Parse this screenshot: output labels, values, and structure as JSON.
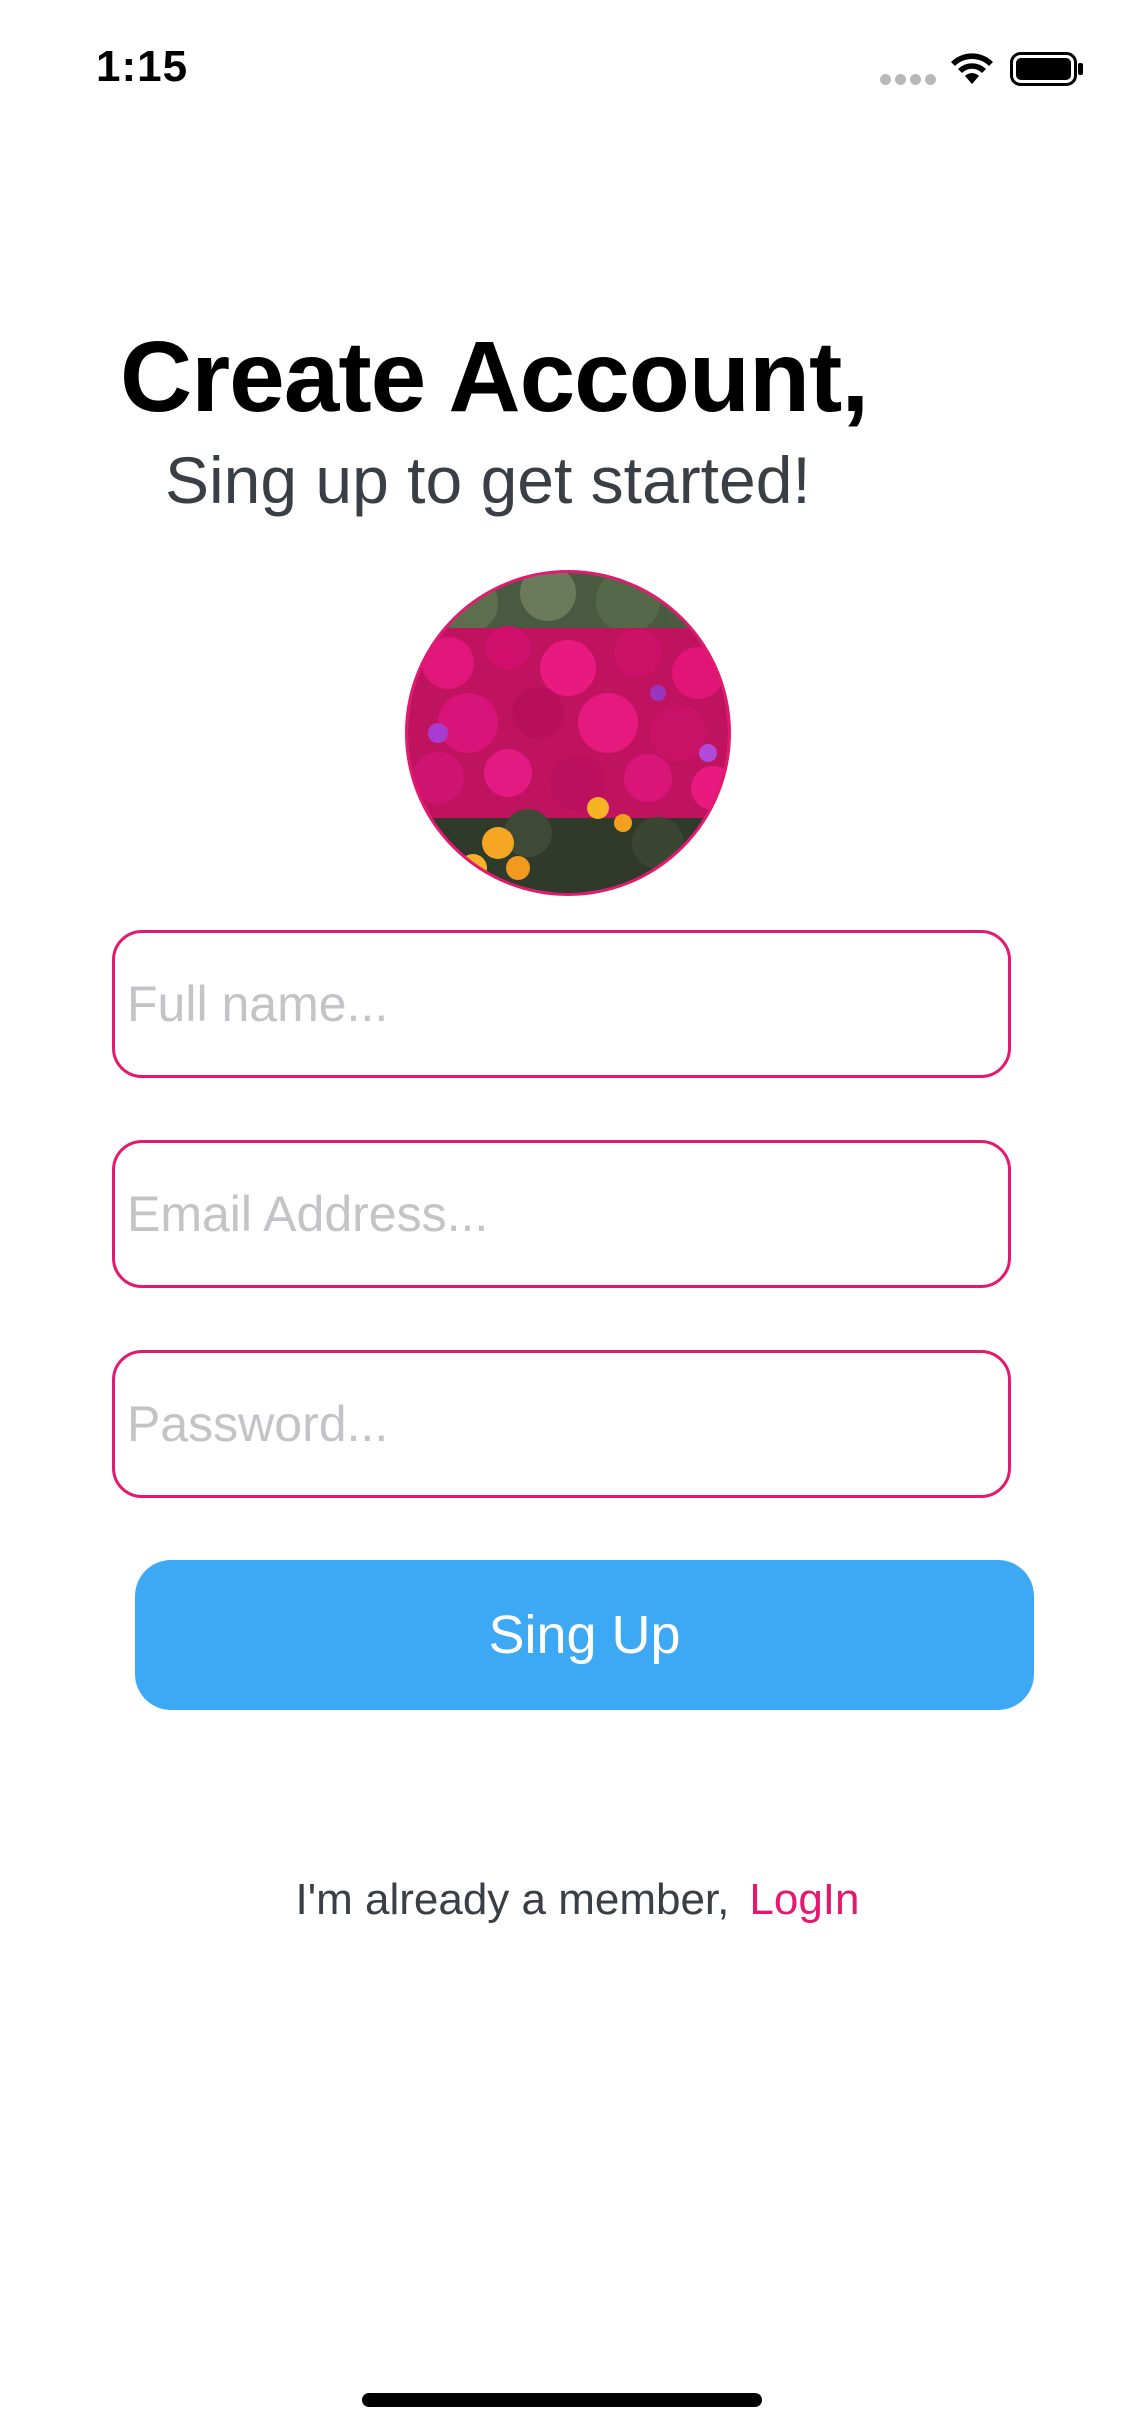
{
  "status_bar": {
    "time": "1:15",
    "icons": [
      "cellular-signal-icon",
      "wifi-icon",
      "battery-icon"
    ]
  },
  "header": {
    "title": "Create Account,",
    "subtitle": "Sing up to get started!"
  },
  "avatar": {
    "icon": "profile-photo-flowers",
    "border_color": "#e6176f"
  },
  "form": {
    "full_name": {
      "value": "",
      "placeholder": "Full name..."
    },
    "email": {
      "value": "",
      "placeholder": "Email Address..."
    },
    "password": {
      "value": "",
      "placeholder": "Password..."
    },
    "submit_label": "Sing Up"
  },
  "footer": {
    "text": "I'm already a member,",
    "link_label": "LogIn"
  },
  "colors": {
    "accent": "#e6176f",
    "button": "#3da9f5",
    "placeholder": "#c3c3c8",
    "subtitle": "#3a3f46"
  }
}
